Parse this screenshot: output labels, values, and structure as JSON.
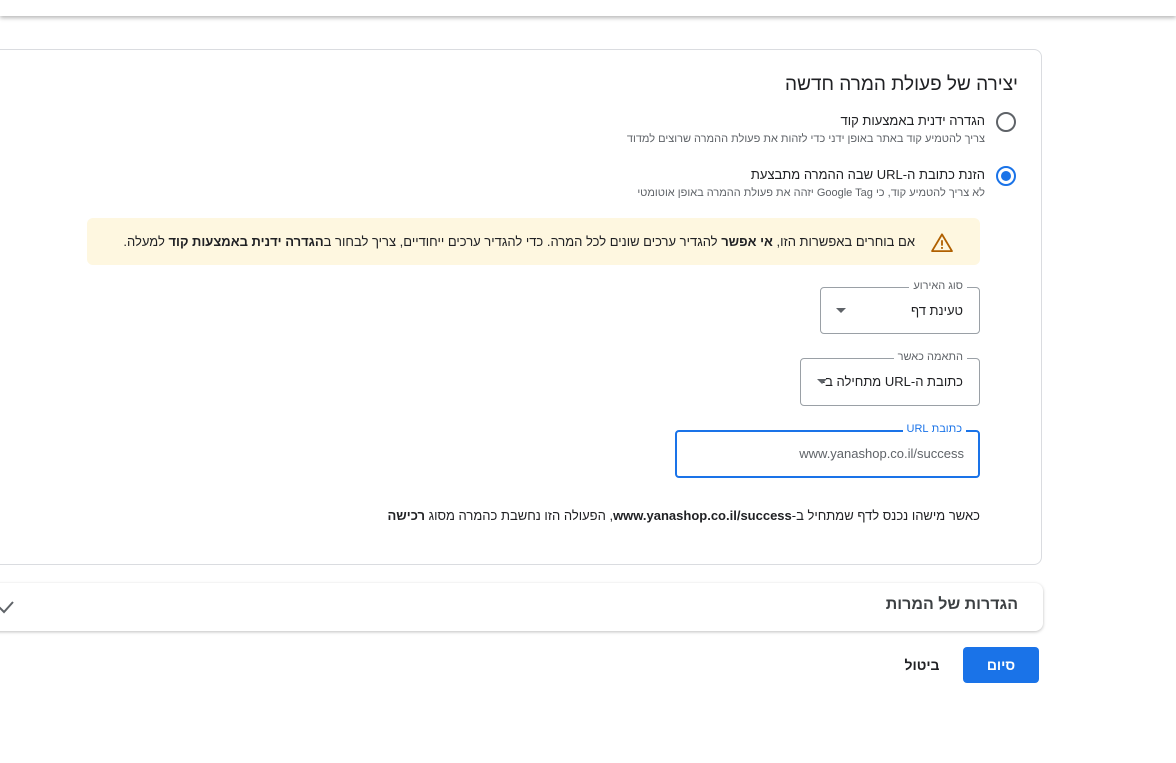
{
  "page": {
    "title": "יצירה של פעולת המרה חדשה"
  },
  "options": [
    {
      "label": "הגדרה ידנית באמצעות קוד",
      "description": "צריך להטמיע קוד באתר באופן ידני כדי לזהות את פעולת ההמרה שרוצים למדוד",
      "selected": false
    },
    {
      "label": "הזנת כתובת ה-URL שבה ההמרה מתבצעת",
      "description": "לא צריך להטמיע קוד, כי Google Tag יזהה את פעולת ההמרה באופן אוטומטי",
      "selected": true
    }
  ],
  "warning": {
    "icon": "warning-icon",
    "color": "#fef7e0",
    "part1": "אם בוחרים באפשרות הזו, ",
    "bold1": "אי אפשר",
    "part2": " להגדיר ערכים שונים לכל המרה. כדי להגדיר ערכים ייחודיים, צריך לבחור ב",
    "bold2": "הגדרה ידנית באמצעות קוד",
    "part3": " למעלה."
  },
  "event_type": {
    "label": "סוג האירוע",
    "value": "טעינת דף"
  },
  "match_type": {
    "label": "התאמה כאשר",
    "value": "כתובת ה-URL מתחילה ב-"
  },
  "url_field": {
    "label": "כתובת URL",
    "value": "www.yanashop.co.il/success"
  },
  "summary": {
    "part1": "כאשר מישהו נכנס לדף שמתחיל ב-",
    "url": "www.yanashop.co.il/success",
    "part2": ", הפעולה הזו נחשבת כהמרה מסוג ",
    "type": "רכישה"
  },
  "settings_section": {
    "title": "הגדרות של המרות"
  },
  "buttons": {
    "done": "סיום",
    "cancel": "ביטול"
  },
  "colors": {
    "primary": "#1a73e8",
    "warning_icon": "#b06000"
  }
}
